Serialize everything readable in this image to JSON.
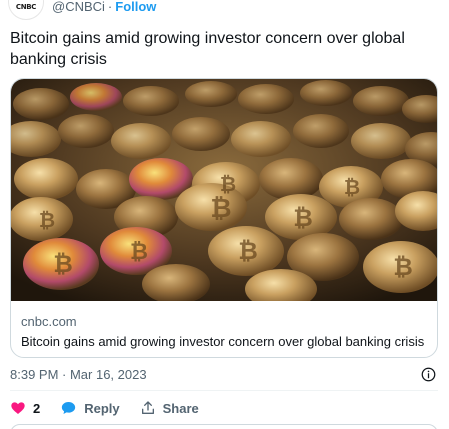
{
  "author": {
    "logo_text": "CNBC",
    "handle": "@CNBCi",
    "separator": "·",
    "follow_label": "Follow"
  },
  "tweet": {
    "text": "Bitcoin gains amid growing investor concern over global banking crisis"
  },
  "card": {
    "image_icon": "bitcoin-coins-photo",
    "domain": "cnbc.com",
    "title": "Bitcoin gains amid growing investor concern over global banking crisis"
  },
  "meta": {
    "timestamp": "8:39 PM · Mar 16, 2023"
  },
  "actions": {
    "like_count": "2",
    "reply_label": "Reply",
    "share_label": "Share"
  },
  "colors": {
    "accent": "#1d9bf0",
    "like": "#f91880",
    "secondary_text": "#536471"
  }
}
